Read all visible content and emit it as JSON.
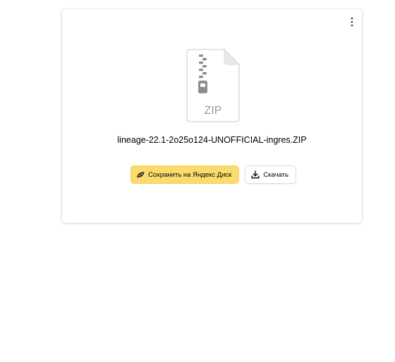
{
  "file": {
    "name": "lineage-22.1-2o25o124-UNOFFICIAL-ingres.ZIP",
    "type_label": "ZIP",
    "icon": "zip-file-icon"
  },
  "actions": {
    "save_label": "Сохранить на Яндекс Диск",
    "save_icon": "yandex-disk-icon",
    "download_label": "Скачать",
    "download_icon": "download-icon"
  },
  "menu": {
    "icon": "more-vertical-icon"
  },
  "colors": {
    "save_button": "#fcdb6e",
    "icon_gray": "#8c8c8c"
  }
}
